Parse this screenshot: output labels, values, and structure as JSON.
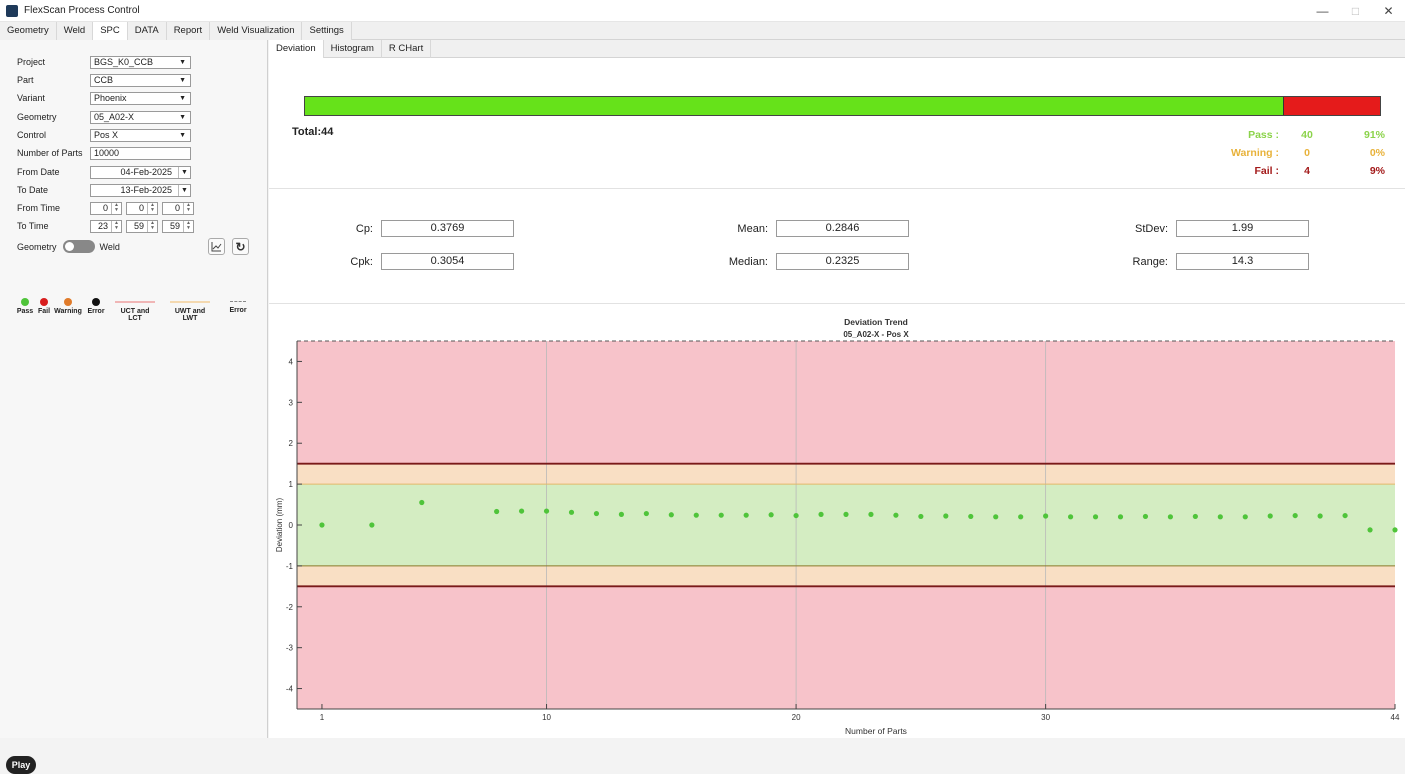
{
  "window": {
    "title": "FlexScan Process Control"
  },
  "menu": [
    "Geometry",
    "Weld",
    "SPC",
    "DATA",
    "Report",
    "Weld Visualization",
    "Settings"
  ],
  "filters": {
    "project": {
      "label": "Project",
      "value": "BGS_K0_CCB"
    },
    "part": {
      "label": "Part",
      "value": "CCB"
    },
    "variant": {
      "label": "Variant",
      "value": "Phoenix"
    },
    "geometry": {
      "label": "Geometry",
      "value": "05_A02-X"
    },
    "control": {
      "label": "Control",
      "value": "Pos X"
    },
    "num_parts": {
      "label": "Number of Parts",
      "value": "10000"
    },
    "from_date": {
      "label": "From Date",
      "value": "04-Feb-2025"
    },
    "to_date": {
      "label": "To Date",
      "value": "13-Feb-2025"
    },
    "from_time": {
      "label": "From Time",
      "h": "0",
      "m": "0",
      "s": "0"
    },
    "to_time": {
      "label": "To Time",
      "h": "23",
      "m": "59",
      "s": "59"
    }
  },
  "toggle": {
    "left": "Geometry",
    "right": "Weld"
  },
  "legend": {
    "pass": "Pass",
    "fail": "Fail",
    "warning": "Warning",
    "error": "Error",
    "uct": "UCT and LCT",
    "uwt": "UWT and LWT",
    "error_line": "Error"
  },
  "play_label": "Play",
  "subtabs": [
    "Deviation",
    "Histogram",
    "R CHart"
  ],
  "summary": {
    "total": "Total:44",
    "pass": {
      "label": "Pass :",
      "count": "40",
      "pct": "91%"
    },
    "warning": {
      "label": "Warning :",
      "count": "0",
      "pct": "0%"
    },
    "fail": {
      "label": "Fail :",
      "count": "4",
      "pct": "9%"
    },
    "pass_fraction": 0.91
  },
  "stats": {
    "cp": {
      "label": "Cp:",
      "value": "0.3769"
    },
    "cpk": {
      "label": "Cpk:",
      "value": "0.3054"
    },
    "mean": {
      "label": "Mean:",
      "value": "0.2846"
    },
    "median": {
      "label": "Median:",
      "value": "0.2325"
    },
    "stdev": {
      "label": "StDev:",
      "value": "1.99"
    },
    "range": {
      "label": "Range:",
      "value": "14.3"
    }
  },
  "colors": {
    "pass": "#4fc43a",
    "fail": "#d81e1e",
    "warning": "#e07b2a",
    "error": "#111111",
    "fail_zone": "#f7c3ca",
    "warn_zone": "#f9dfc4",
    "ok_zone": "#d4edc2",
    "control_line": "#7a1a1a",
    "pass_bar": "#66e21a",
    "fail_bar": "#e51b1b"
  },
  "chart_data": {
    "type": "scatter",
    "title": "Deviation Trend",
    "subtitle": "05_A02-X - Pos X",
    "xlabel": "Number of Parts",
    "ylabel": "Deviation (mm)",
    "xlim": [
      0,
      44
    ],
    "ylim": [
      -4.5,
      4.5
    ],
    "x_ticks": [
      1,
      10,
      20,
      30,
      44
    ],
    "y_ticks": [
      4,
      3,
      2,
      1,
      0,
      -1,
      -2,
      -3,
      -4
    ],
    "upper_control": 1.5,
    "lower_control": -1.5,
    "upper_warning": 1.0,
    "lower_warning": -1.0,
    "error_limit": 4.5,
    "x": [
      1,
      3,
      5,
      8,
      9,
      10,
      11,
      12,
      13,
      14,
      15,
      16,
      17,
      18,
      19,
      20,
      21,
      22,
      23,
      24,
      25,
      26,
      27,
      28,
      29,
      30,
      31,
      32,
      33,
      34,
      35,
      36,
      37,
      38,
      39,
      40,
      41,
      42,
      43,
      44
    ],
    "y": [
      0.0,
      0.0,
      0.55,
      0.33,
      0.34,
      0.34,
      0.31,
      0.28,
      0.26,
      0.28,
      0.25,
      0.24,
      0.24,
      0.24,
      0.25,
      0.23,
      0.26,
      0.26,
      0.26,
      0.24,
      0.21,
      0.22,
      0.21,
      0.2,
      0.2,
      0.22,
      0.2,
      0.2,
      0.2,
      0.21,
      0.2,
      0.21,
      0.2,
      0.2,
      0.22,
      0.23,
      0.22,
      0.23,
      -0.12,
      -0.12,
      0.0
    ]
  }
}
